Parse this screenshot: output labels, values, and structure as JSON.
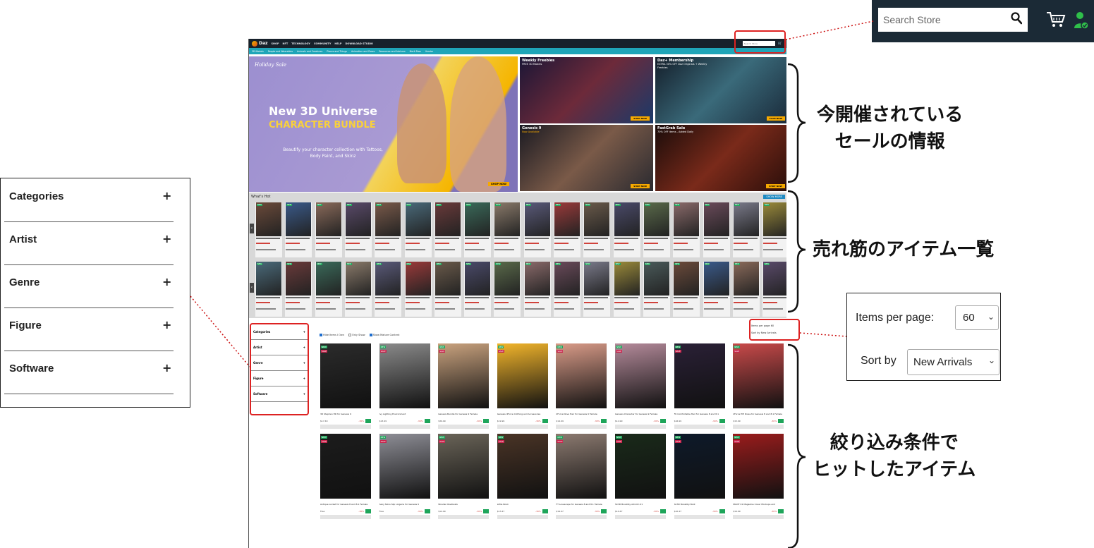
{
  "store": {
    "logo_text": "Daz",
    "nav_links": [
      "SHOP",
      "NFT",
      "TECHNOLOGY",
      "COMMUNITY",
      "HELP",
      "DOWNLOAD STUDIO"
    ],
    "mini_search_placeholder": "Search Store",
    "sub_nav": [
      "3D Models",
      "People and Wearables",
      "Animals and Creatures",
      "Places and Things",
      "Animation and Poses",
      "Resources and Add-ons",
      "Merit Pass",
      "Vendor"
    ]
  },
  "hero": {
    "main": {
      "eyebrow": "Holiday Sale",
      "headline_1": "New 3D Universe",
      "headline_2": "CHARACTER BUNDLE",
      "description": "Beautify your character collection with Tattoos, Body Paint, and Skinz",
      "cta": "SHOP NOW"
    },
    "tiles": [
      {
        "title": "Weekly Freebies",
        "subtitle": "FREE 3D Models",
        "cta": "SHOP NOW",
        "color": "#2a1e4a"
      },
      {
        "title": "Daz+ Membership",
        "subtitle": "EXTRA 30% OFF Daz Originals + Weekly Freebies",
        "cta": "PLAN NOW",
        "color": "#1e3a50"
      },
      {
        "title": "Genesis 9",
        "subtitle": "Now Available",
        "cta": "SHOP NOW",
        "color": "#3a2a1e"
      },
      {
        "title": "FastGrab Sale",
        "subtitle": "70% OFF items - Added Daily",
        "cta": "SHOP NOW",
        "color": "#4a1712"
      }
    ]
  },
  "whats_hot": {
    "title": "What's Hot",
    "show_more": "SHOW MORE"
  },
  "filter_mini": [
    "Categories",
    "Artist",
    "Genre",
    "Figure",
    "Software"
  ],
  "listing_options": [
    "Hide Items I Own",
    "Only Show",
    "Show Mature Content"
  ],
  "mini_per_page": {
    "label": "Items per page",
    "value": "60",
    "sort_label": "Sort by",
    "sort_value": "New Arrivals"
  },
  "grid_products": [
    {
      "name": "3D Stephen HD for Genesis 9",
      "price": "$17.49",
      "discount": "-30%",
      "color": "#2b2b2b"
    },
    {
      "name": "Ivy Lighting Environment",
      "price": "$13.99",
      "discount": "-30%",
      "color": "#8a8a8a"
    },
    {
      "name": "Genesis Bundle for Genesis 9 Female",
      "price": "$39.99",
      "discount": "-30%",
      "color": "#c9a27e"
    },
    {
      "name": "Genesis dForce Clothing and Accessories",
      "price": "$19.99",
      "discount": "-30%",
      "color": "#f2b52b"
    },
    {
      "name": "dForce Nova Hair for Genesis 9 Female",
      "price": "$14.99",
      "discount": "-30%",
      "color": "#d99b88"
    },
    {
      "name": "Genesis Character for Genesis 9 Female",
      "price": "$14.99",
      "discount": "-30%",
      "color": "#b48a9a"
    },
    {
      "name": "FK Comfortable Hair for Genesis 8 and 8.1",
      "price": "$16.99",
      "discount": "-30%",
      "color": "#2a2036"
    },
    {
      "name": "dForce Elfi Dress for Genesis 8 and 8.1 Female",
      "price": "$15.99",
      "discount": "-30%",
      "color": "#c94a4a"
    },
    {
      "name": "Antique Locket for Genesis 8 and 8.1 Female",
      "price": "Free",
      "discount": "-30%",
      "color": "#1c1c1c"
    },
    {
      "name": "Sexy Skins Slip Lingerie for Genesis 9",
      "price": "Free",
      "discount": "-30%",
      "color": "#8e8e96"
    },
    {
      "name": "Wooden Rowboats",
      "price": "$12.99",
      "discount": "-30%",
      "color": "#6a6458"
    },
    {
      "name": "Little Nook",
      "price": "$13.47",
      "discount": "-30%",
      "color": "#4a3426"
    },
    {
      "name": "FT Lovescape for Genesis 8 and 8.1 Female",
      "price": "$19.97",
      "discount": "-30%",
      "color": "#8c7a70"
    },
    {
      "name": "SC3D Boostiby Add-On 01",
      "price": "$10.47",
      "discount": "-30%",
      "color": "#1a2a1a"
    },
    {
      "name": "SC3D Boostiby Boot",
      "price": "$10.47",
      "discount": "-30%",
      "color": "#0e1a2a"
    },
    {
      "name": "MAXIT 01 Magazine Cover Mockups and",
      "price": "$19.99",
      "discount": "-30%",
      "color": "#9a1c1c"
    }
  ],
  "badges": {
    "new": "NEW",
    "sale": "SALE"
  },
  "callouts": {
    "filter_panel": [
      "Categories",
      "Artist",
      "Genre",
      "Figure",
      "Software"
    ],
    "search_placeholder": "Search Store",
    "per_page_label": "Items per page:",
    "per_page_value": "60",
    "sort_label": "Sort by",
    "sort_value": "New Arrivals"
  },
  "annotations": {
    "sales_line1": "今開催されている",
    "sales_line2": "セールの情報",
    "bestsellers": "売れ筋のアイテム一覧",
    "filtered_line1": "絞り込み条件で",
    "filtered_line2": "ヒットしたアイテム"
  },
  "colors": {
    "accent_red": "#dd2222",
    "nav_dark": "#17212b",
    "teal": "#1fa5b8",
    "badge_green": "#1ea55a",
    "badge_pink": "#c8244c"
  }
}
